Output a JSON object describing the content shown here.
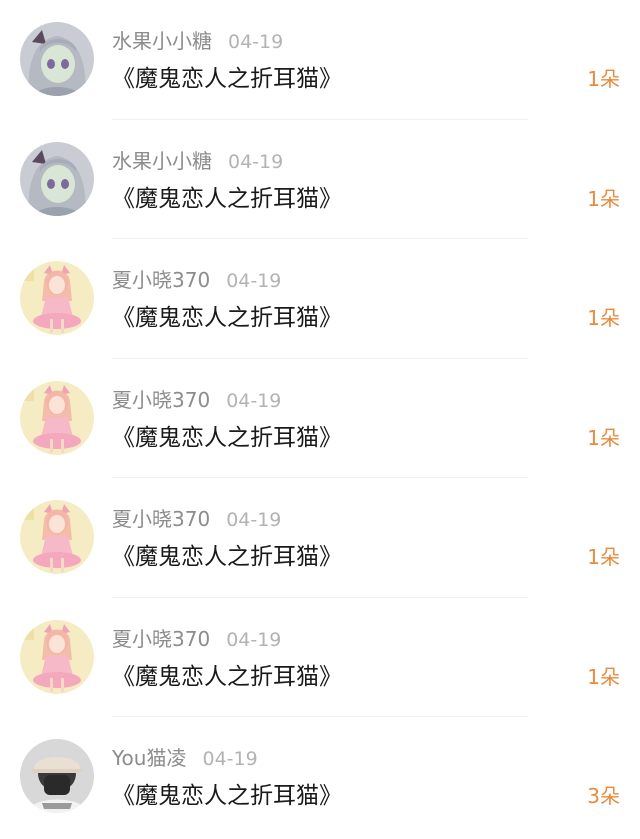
{
  "items": [
    {
      "username": "水果小小糖",
      "date": "04-19",
      "title": "《魔鬼恋人之折耳猫》",
      "gift": "1朵",
      "avatar": "anime-avatar-gray"
    },
    {
      "username": "水果小小糖",
      "date": "04-19",
      "title": "《魔鬼恋人之折耳猫》",
      "gift": "1朵",
      "avatar": "anime-avatar-gray"
    },
    {
      "username": "夏小晓370",
      "date": "04-19",
      "title": "《魔鬼恋人之折耳猫》",
      "gift": "1朵",
      "avatar": "anime-avatar-pink"
    },
    {
      "username": "夏小晓370",
      "date": "04-19",
      "title": "《魔鬼恋人之折耳猫》",
      "gift": "1朵",
      "avatar": "anime-avatar-pink"
    },
    {
      "username": "夏小晓370",
      "date": "04-19",
      "title": "《魔鬼恋人之折耳猫》",
      "gift": "1朵",
      "avatar": "anime-avatar-pink"
    },
    {
      "username": "夏小晓370",
      "date": "04-19",
      "title": "《魔鬼恋人之折耳猫》",
      "gift": "1朵",
      "avatar": "anime-avatar-pink"
    },
    {
      "username": "You猫凌",
      "date": "04-19",
      "title": "《魔鬼恋人之折耳猫》",
      "gift": "3朵",
      "avatar": "photo-avatar-cap"
    }
  ],
  "colors": {
    "username": "#8c8c8c",
    "date": "#b3b3b3",
    "title": "#1a1a1a",
    "gift": "#e98a3d",
    "divider": "#f0f0f0"
  }
}
